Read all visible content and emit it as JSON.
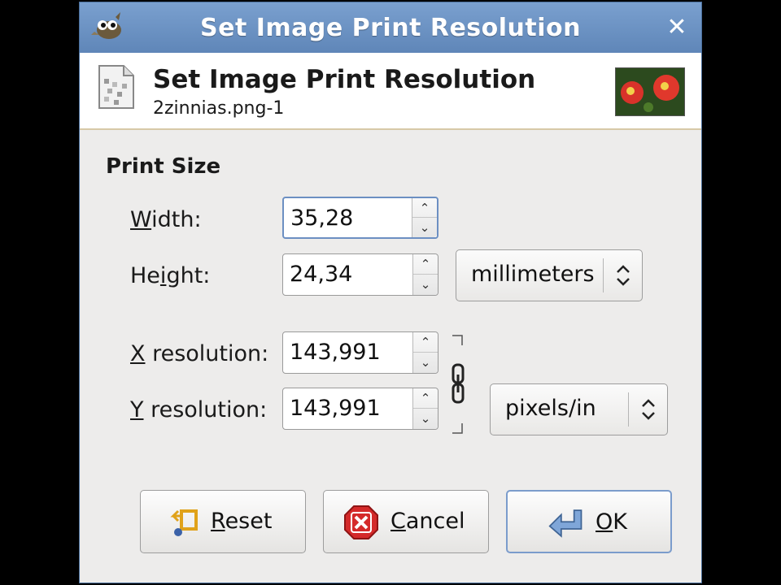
{
  "window": {
    "title": "Set Image Print Resolution",
    "close_symbol": "✕"
  },
  "header": {
    "title": "Set Image Print Resolution",
    "subtitle": "2zinnias.png-1"
  },
  "print_size": {
    "section_title": "Print Size",
    "width": {
      "mnemonic": "W",
      "rest": "idth:",
      "value": "35,28"
    },
    "height": {
      "pre": "He",
      "mnemonic": "i",
      "rest": "ght:",
      "value": "24,34"
    },
    "size_unit": "millimeters",
    "x_resolution": {
      "mnemonic": "X",
      "rest": " resolution:",
      "value": "143,991"
    },
    "y_resolution": {
      "mnemonic": "Y",
      "rest": " resolution:",
      "value": "143,991"
    },
    "resolution_unit": "pixels/in"
  },
  "buttons": {
    "reset": {
      "mnemonic": "R",
      "rest": "eset"
    },
    "cancel": {
      "mnemonic": "C",
      "rest": "ancel"
    },
    "ok": {
      "mnemonic": "O",
      "rest": "K"
    }
  },
  "icons": {
    "app": "gimp-wilber-icon",
    "document": "image-document-icon",
    "thumbnail": "image-thumbnail",
    "chain": "chain-link-icon",
    "reset": "reset-icon",
    "cancel": "cancel-icon",
    "ok": "ok-arrow-icon"
  },
  "colors": {
    "titlebar": "#6a90c2",
    "dialog_bg": "#edeceb",
    "focus_border": "#6c8fc2",
    "cancel_red": "#d42a2a"
  }
}
